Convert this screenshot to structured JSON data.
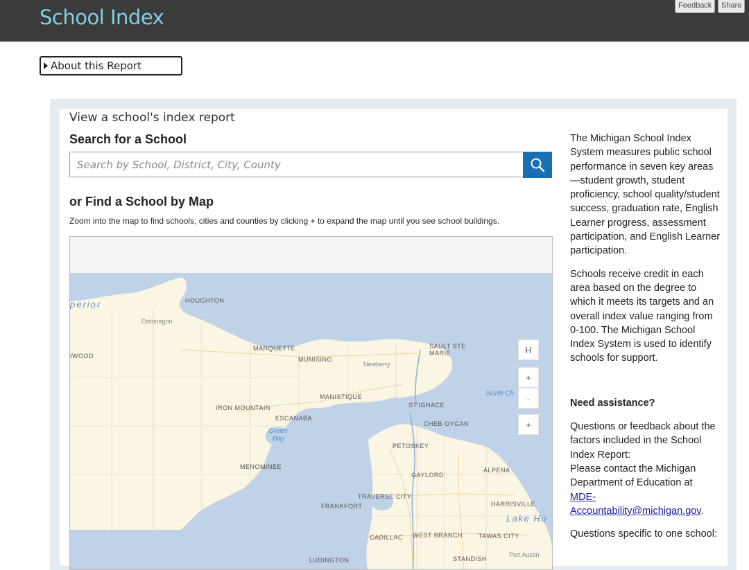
{
  "header": {
    "title": "School Index",
    "feedback_label": "Feedback",
    "share_label": "Share"
  },
  "about": {
    "label": "About this Report"
  },
  "main": {
    "view_title": "View a school's index report",
    "search_heading": "Search for a School",
    "search_placeholder": "Search by School, District, City, County",
    "map_heading": "or Find a School by Map",
    "map_instructions": "Zoom into the map to find schools, cities and counties by clicking + to expand the map until you see school buildings."
  },
  "map": {
    "controls": {
      "home": "H",
      "zoom_in": "+",
      "zoom_out": "-",
      "locate": "+"
    },
    "labels": {
      "superior": "perior",
      "houghton": "HOUGHTON",
      "ontonagon": "Ontonagon",
      "ironwood": "IWOOD",
      "marquette": "MARQUETTE",
      "munising": "MUNISING",
      "newberry": "Newberry",
      "sault": "SAULT STE",
      "marie": "MARIE",
      "north_channel": "North Ch",
      "manistique": "MANISTIQUE",
      "iron_mountain": "IRON MOUNTAIN",
      "escanaba": "ESCANABA",
      "st_ignace": "ST.IGNACE",
      "cheboygan": "CHEB OYGAN",
      "green": "Green",
      "bay": "Bay",
      "petoskey": "PETOSKEY",
      "menominee": "MENOMINEE",
      "gaylord": "GAYLORD",
      "alpena": "ALPENA",
      "traverse_city": "TRAVERSE CITY",
      "frankfort": "FRANKFORT",
      "harrisville": "HARRISVILLE",
      "lake_huron": "Lake Hu",
      "cadillac": "CADILLAC",
      "west_branch": "WEST BRANCH",
      "tawas_city": "TAWAS CITY",
      "ludington": "LUDINGTON",
      "standish": "STANDISH",
      "port_austin": "Port Austin"
    }
  },
  "sidebar": {
    "intro": "The Michigan School Index System measures public school performance in seven key areas—student growth, student proficiency, school quality/student success, graduation rate, English Learner progress, assessment participation, and English Learner participation.",
    "credit": "Schools receive credit in each area based on the degree to which it meets its targets and an overall index value ranging from 0-100. The Michigan School Index System is used to identify schools for support.",
    "assist_heading": "Need assistance?",
    "feedback_text": "Questions or feedback about the factors included in the School Index Report:",
    "contact_text": "Please contact the Michigan Department of Education at",
    "email": "MDE-Accountability@michigan.gov",
    "email_suffix": ".",
    "specific_text": "Questions specific to one school:"
  },
  "colors": {
    "topbar": "#3b3b3b",
    "title": "#7fd0e3",
    "accent": "#1a6fb2",
    "panel": "#e4ebf1",
    "water": "#bfd2e7",
    "land": "#fbf5e4"
  },
  "icons": {
    "search_button": "search-icon",
    "about_toggle": "caret-right-icon"
  }
}
